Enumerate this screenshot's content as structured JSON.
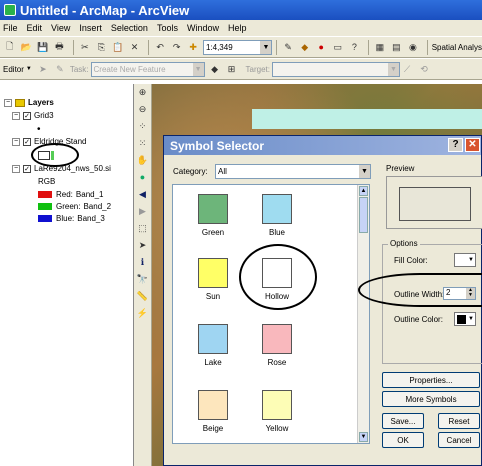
{
  "window": {
    "title": "Untitled - ArcMap - ArcView"
  },
  "menu": [
    "File",
    "Edit",
    "View",
    "Insert",
    "Selection",
    "Tools",
    "Window",
    "Help"
  ],
  "toolbar": {
    "scale": "1:4,349",
    "spatial_analyst": "Spatial Analys",
    "editor": "Editor",
    "task_label": "Task:",
    "task_value": "Create New Feature",
    "target_label": "Target:"
  },
  "toc": {
    "layers": "Layers",
    "grid3": "Grid3",
    "eldridge": "Eldridge Stand",
    "raster": "LaRe9204_nws_50.si",
    "rgb": "RGB",
    "bands": [
      {
        "label": "Red:",
        "value": "Band_1",
        "color": "#e01010"
      },
      {
        "label": "Green:",
        "value": "Band_2",
        "color": "#10c010"
      },
      {
        "label": "Blue:",
        "value": "Band_3",
        "color": "#1010d0"
      }
    ]
  },
  "dialog": {
    "title": "Symbol Selector",
    "category_label": "Category:",
    "category_value": "All",
    "preview_label": "Preview",
    "options_label": "Options",
    "fill_color_label": "Fill Color:",
    "outline_width_label": "Outline Width:",
    "outline_width_value": "2",
    "outline_color_label": "Outline Color:",
    "symbols": [
      {
        "name": "Green",
        "color": "#6db57a"
      },
      {
        "name": "Blue",
        "color": "#9fdcf0"
      },
      {
        "name": "Sun",
        "color": "#ffff66"
      },
      {
        "name": "Hollow",
        "color": "#ffffff"
      },
      {
        "name": "Lake",
        "color": "#9fd5f2"
      },
      {
        "name": "Rose",
        "color": "#f9b8bd"
      },
      {
        "name": "Beige",
        "color": "#fde6bd"
      },
      {
        "name": "Yellow",
        "color": "#fdfdb6"
      }
    ],
    "buttons": {
      "properties": "Properties...",
      "more_symbols": "More Symbols",
      "save": "Save...",
      "reset": "Reset",
      "ok": "OK",
      "cancel": "Cancel"
    }
  }
}
